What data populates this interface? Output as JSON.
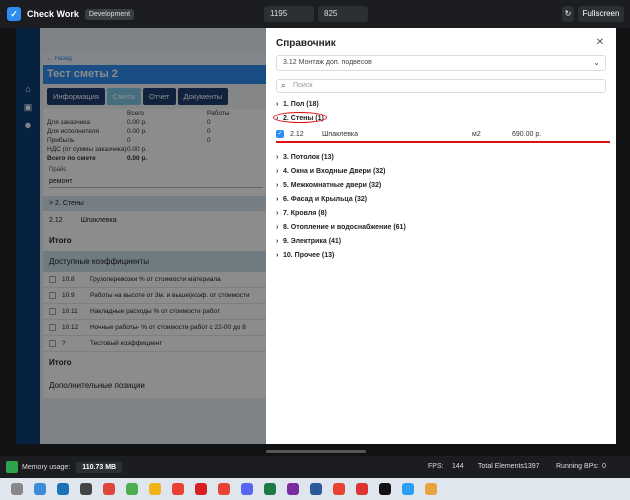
{
  "topbar": {
    "app_title": "Check Work",
    "env_badge": "Development",
    "width_value": "1195",
    "height_value": "825",
    "fullscreen_label": "Fullscreen"
  },
  "app": {
    "back_label": "Назад",
    "title": "Тест сметы 2",
    "tabs": [
      "Информация",
      "Смета",
      "Отчет",
      "Документы"
    ],
    "summary": {
      "col_total": "Всего",
      "col_works": "Работы",
      "rows": [
        {
          "label": "Для заказчика",
          "total": "0.00 р.",
          "works": "0"
        },
        {
          "label": "Для исполнителя",
          "total": "0.00 р.",
          "works": "0"
        },
        {
          "label": "Прибыль",
          "total": "0",
          "works": "0"
        },
        {
          "label": "НДС (от суммы заказчика)",
          "total": "0.00 р.",
          "works": ""
        },
        {
          "label": "Всего по смете",
          "total": "0.00 р.",
          "works": ""
        }
      ]
    },
    "price_label": "Прайс",
    "price_value": "ремонт",
    "section_row": "2. Стены",
    "item": {
      "code": "2.12",
      "name": "Шпаклевка"
    },
    "itogo1": "Итого",
    "koef_head": "Доступные коэффициенты",
    "koef": [
      {
        "code": "10.8",
        "name": "Грузоперевозки % от стоимости материала"
      },
      {
        "code": "10.9",
        "name": "Работы на высоте от 3м. и выше(коэф. от стоимости"
      },
      {
        "code": "10.11",
        "name": "Накладные расходы % от стоимости работ"
      },
      {
        "code": "10.12",
        "name": "Ночные работы- % от стоимости работ с 22-00 до 8"
      },
      {
        "code": "?",
        "name": "Тестовый коэффициент"
      }
    ],
    "itogo2": "Итого",
    "dop": "Дополнительные позиции"
  },
  "drawer": {
    "title": "Справочник",
    "selected": "3.12 Монтаж доп. подвесов",
    "search_placeholder": "Поиск",
    "tree": [
      {
        "label": "1. Пол (18)"
      },
      {
        "label": "2. Стены (1)",
        "expanded": true
      },
      {
        "label": "3. Потолок (13)"
      },
      {
        "label": "4. Окна и Входные Двери (32)"
      },
      {
        "label": "5. Межкомнатные двери (32)"
      },
      {
        "label": "6. Фасад и Крыльца (32)"
      },
      {
        "label": "7. Кровля (8)"
      },
      {
        "label": "8. Отопление и водоснабжение (61)"
      },
      {
        "label": "9. Электрика (41)"
      },
      {
        "label": "10. Прочее (13)"
      }
    ],
    "leaf": {
      "code": "2.12",
      "name": "Шпаклевка",
      "unit": "м2",
      "price": "690.00 р."
    }
  },
  "status": {
    "memory_label": "Memory usage:",
    "memory_value": "110.73 MB",
    "fps_label": "FPS:",
    "fps_value": "144",
    "total_label": "Total Elements:",
    "total_value": "1397",
    "bp_label": "Running BPs:",
    "bp_value": "0"
  },
  "colors": {
    "accent": "#2f8cf0",
    "nav": "#0b3e74",
    "annotation": "#d11"
  }
}
